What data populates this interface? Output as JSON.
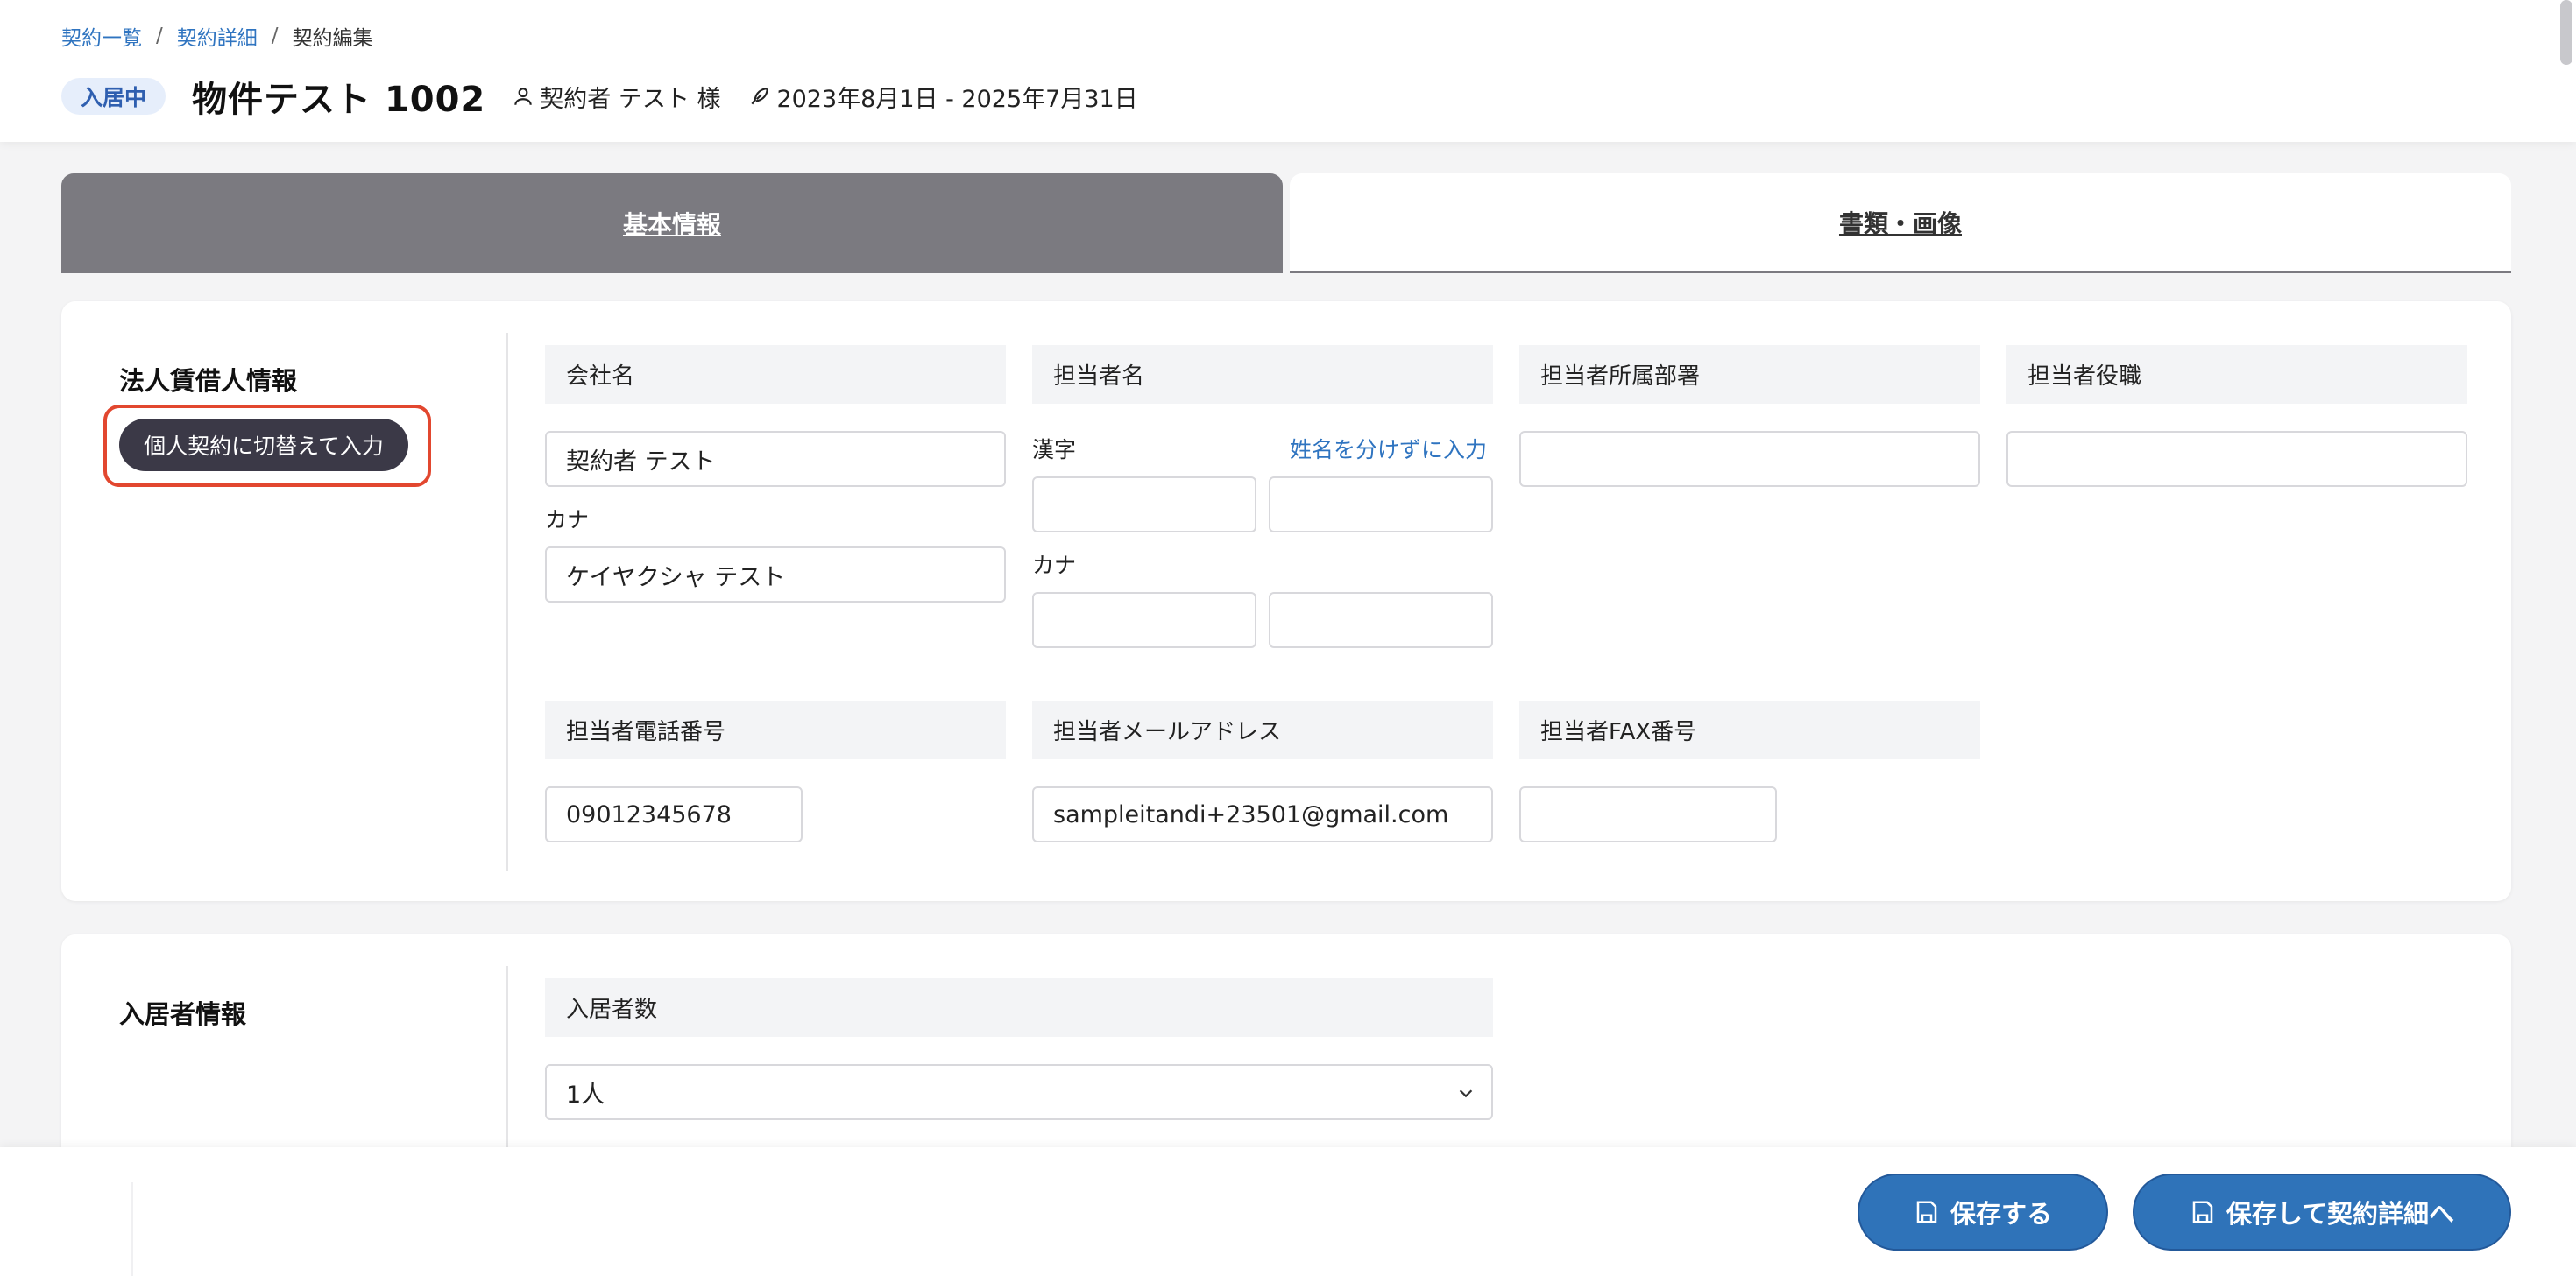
{
  "breadcrumb": {
    "items": [
      {
        "label": "契約一覧"
      },
      {
        "label": "契約詳細"
      }
    ],
    "current": "契約編集",
    "separator": "/"
  },
  "header": {
    "status_badge": "入居中",
    "property_name": "物件テスト 1002",
    "contractor": "契約者 テスト 様",
    "period": "2023年8月1日 - 2025年7月31日"
  },
  "tabs": [
    {
      "label": "基本情報",
      "active": true
    },
    {
      "label": "書類・画像",
      "active": false
    }
  ],
  "corporate": {
    "title": "法人賃借人情報",
    "switch_button": "個人契約に切替えて入力",
    "company_name": {
      "label": "会社名",
      "value": "契約者 テスト",
      "kana_label": "カナ",
      "kana_value": "ケイヤクシャ テスト"
    },
    "contact_name": {
      "label": "担当者名",
      "kanji_label": "漢字",
      "split_link": "姓名を分けずに入力",
      "kana_label": "カナ",
      "last": "",
      "first": "",
      "kana_last": "",
      "kana_first": ""
    },
    "department": {
      "label": "担当者所属部署",
      "value": ""
    },
    "position": {
      "label": "担当者役職",
      "value": ""
    },
    "phone": {
      "label": "担当者電話番号",
      "value": "09012345678"
    },
    "email": {
      "label": "担当者メールアドレス",
      "value": "sampleitandi+23501@gmail.com"
    },
    "fax": {
      "label": "担当者FAX番号",
      "value": ""
    }
  },
  "occupants": {
    "title": "入居者情報",
    "count_label": "入居者数",
    "count_value": "1人"
  },
  "actions": {
    "save": "保存する",
    "save_and_detail": "保存して契約詳細へ"
  },
  "colors": {
    "accent": "#2f73b9",
    "tab_active": "#7b7a80",
    "highlight": "#e2472f",
    "link": "#2f74c0"
  }
}
